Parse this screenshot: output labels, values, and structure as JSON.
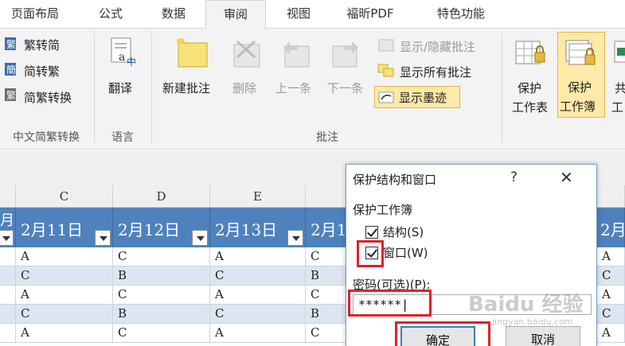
{
  "tabs": [
    "页面布局",
    "公式",
    "数据",
    "审阅",
    "视图",
    "福昕PDF",
    "特色功能"
  ],
  "ribbon": {
    "chinese": {
      "to_trad": "繁转简",
      "to_simp": "简转繁",
      "convert": "简繁转换",
      "group": "中文简繁转换"
    },
    "language": {
      "translate": "翻译",
      "group": "语言"
    },
    "comments": {
      "new": "新建批注",
      "delete": "删除",
      "prev": "上一条",
      "next": "下一条",
      "show_hide": "显示/隐藏批注",
      "show_all": "显示所有批注",
      "show_ink": "显示墨迹",
      "group": "批注"
    },
    "protect": {
      "sheet": "保护",
      "sheet2": "工作表",
      "book": "保护",
      "book2": "工作簿",
      "partial": "共",
      "partial2": "工"
    }
  },
  "sheet": {
    "columns": [
      "C",
      "D",
      "E"
    ],
    "row_header_partial": "月",
    "headers": [
      "2月11日",
      "2月12日",
      "2月13日",
      "2月1",
      "2月"
    ],
    "rows": [
      [
        "A",
        "C",
        "A",
        "C",
        "A"
      ],
      [
        "C",
        "B",
        "C",
        "B",
        "C"
      ],
      [
        "A",
        "C",
        "A",
        "C",
        "A"
      ],
      [
        "C",
        "B",
        "C",
        "B",
        "C"
      ],
      [
        "A",
        "C",
        "A",
        "C",
        "A"
      ]
    ]
  },
  "dialog": {
    "title": "保护结构和窗口",
    "help": "?",
    "close": "✕",
    "section": "保护工作簿",
    "structure": "结构(S)",
    "windows": "窗口(W)",
    "password_label": "密码(可选)(P):",
    "password_value": "******|",
    "ok": "确定",
    "cancel": "取消"
  },
  "watermark": {
    "main": "Baidu 经验",
    "sub": "jingyan.baidu.com"
  },
  "colors": {
    "header_blue": "#4f81bd",
    "band": "#dce6f1",
    "highlight_red": "#e0202a"
  }
}
